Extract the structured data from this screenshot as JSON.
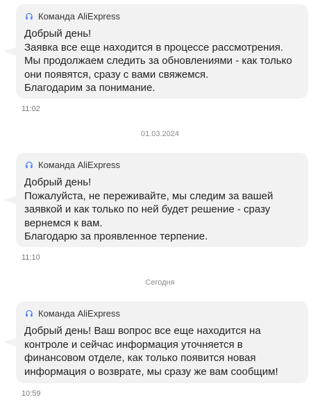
{
  "messages": [
    {
      "sender": "Команда AliExpress",
      "text": "Добрый день!\nЗаявка все еще находится в процессе рассмотрения.\nМы продолжаем следить за обновлениями - как только они появятся, сразу с вами свяжемся.\nБлагодарим за понимание.",
      "time": "11:02"
    },
    {
      "date_separator": "01.03.2024",
      "sender": "Команда AliExpress",
      "text": "Добрый день!\nПожалуйста, не переживайте, мы следим за вашей заявкой и как только по ней будет решение - сразу вернемся к вам.\nБлагодарю за проявленное терпение.",
      "time": "11:10"
    },
    {
      "date_separator": "Сегодня",
      "sender": "Команда AliExpress",
      "text": "Добрый день! Ваш вопрос все еще находится на контроле и сейчас информация уточняется в финансовом отделе, как только появится новая информация о возврате, мы сразу же вам сообщим!",
      "time": "10:59"
    }
  ],
  "colors": {
    "bubble": "#f2f2f2",
    "headset_icon": "#3d7bf7"
  },
  "icons": {
    "sender_icon": "headset-icon"
  }
}
